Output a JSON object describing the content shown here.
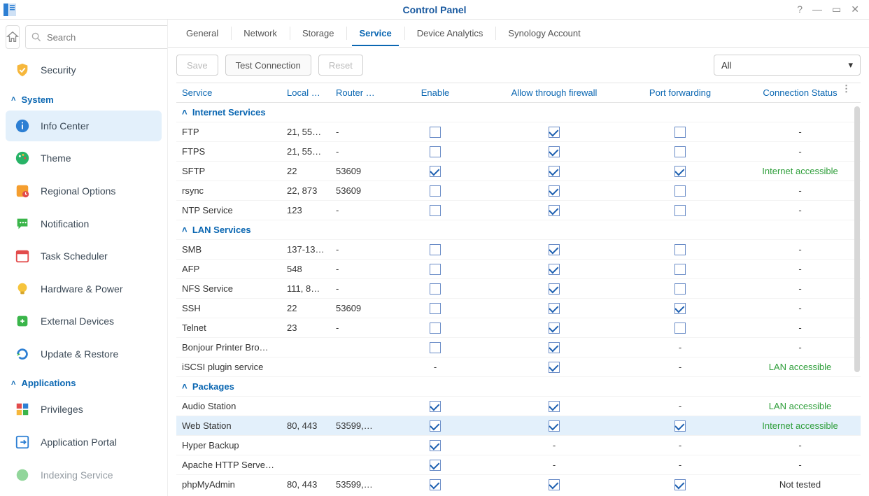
{
  "window": {
    "title": "Control Panel"
  },
  "sidebar": {
    "search_placeholder": "Search",
    "security_label": "Security",
    "groups": {
      "system": {
        "label": "System"
      },
      "applications": {
        "label": "Applications"
      }
    },
    "items": {
      "info_center": "Info Center",
      "theme": "Theme",
      "regional": "Regional Options",
      "notification": "Notification",
      "task_scheduler": "Task Scheduler",
      "hardware_power": "Hardware & Power",
      "external_devices": "External Devices",
      "update_restore": "Update & Restore",
      "privileges": "Privileges",
      "app_portal": "Application Portal",
      "indexing": "Indexing Service"
    }
  },
  "tabs": {
    "general": "General",
    "network": "Network",
    "storage": "Storage",
    "service": "Service",
    "device_analytics": "Device Analytics",
    "synology_account": "Synology Account"
  },
  "toolbar": {
    "save": "Save",
    "test": "Test Connection",
    "reset": "Reset",
    "filter": "All"
  },
  "columns": {
    "service": "Service",
    "local_port": "Local P…",
    "router_port": "Router …",
    "enable": "Enable",
    "firewall": "Allow through firewall",
    "port_forwarding": "Port forwarding",
    "conn_status": "Connection Status"
  },
  "sections": {
    "internet": "Internet Services",
    "lan": "LAN Services",
    "packages": "Packages"
  },
  "rows": {
    "ftp": {
      "name": "FTP",
      "local": "21, 55…",
      "router": "-",
      "en": false,
      "fw": true,
      "pf": false,
      "pf_box": true,
      "status": "-"
    },
    "ftps": {
      "name": "FTPS",
      "local": "21, 55…",
      "router": "-",
      "en": false,
      "fw": true,
      "pf": false,
      "pf_box": true,
      "status": "-"
    },
    "sftp": {
      "name": "SFTP",
      "local": "22",
      "router": "53609",
      "en": true,
      "fw": true,
      "pf": true,
      "pf_box": true,
      "status": "Internet accessible",
      "green": true
    },
    "rsync": {
      "name": "rsync",
      "local": "22, 873",
      "router": "53609",
      "en": false,
      "fw": true,
      "pf": false,
      "pf_box": true,
      "status": "-"
    },
    "ntp": {
      "name": "NTP Service",
      "local": "123",
      "router": "-",
      "en": false,
      "fw": true,
      "pf": false,
      "pf_box": true,
      "status": "-"
    },
    "smb": {
      "name": "SMB",
      "local": "137-13…",
      "router": "-",
      "en": false,
      "fw": true,
      "pf": false,
      "pf_box": true,
      "status": "-"
    },
    "afp": {
      "name": "AFP",
      "local": "548",
      "router": "-",
      "en": false,
      "fw": true,
      "pf": false,
      "pf_box": true,
      "status": "-"
    },
    "nfs": {
      "name": "NFS Service",
      "local": "111, 8…",
      "router": "-",
      "en": false,
      "fw": true,
      "pf": false,
      "pf_box": true,
      "status": "-"
    },
    "ssh": {
      "name": "SSH",
      "local": "22",
      "router": "53609",
      "en": false,
      "fw": true,
      "pf": true,
      "pf_box": true,
      "status": "-"
    },
    "telnet": {
      "name": "Telnet",
      "local": "23",
      "router": "-",
      "en": false,
      "fw": true,
      "pf": false,
      "pf_box": true,
      "status": "-"
    },
    "bonjour": {
      "name": "Bonjour Printer Bro…",
      "local": "",
      "router": "",
      "en": false,
      "fw": true,
      "pf_dash": true,
      "status": "-"
    },
    "iscsi": {
      "name": "iSCSI plugin service",
      "local": "",
      "router": "",
      "en_dash": true,
      "fw": true,
      "pf_dash": true,
      "status": "LAN accessible",
      "green": true
    },
    "audio": {
      "name": "Audio Station",
      "local": "",
      "router": "",
      "en": true,
      "fw": true,
      "pf_dash": true,
      "status": "LAN accessible",
      "green": true
    },
    "web": {
      "name": "Web Station",
      "local": "80, 443",
      "router": "53599,…",
      "en": true,
      "fw": true,
      "pf": true,
      "pf_box": true,
      "status": "Internet accessible",
      "green": true
    },
    "hyper": {
      "name": "Hyper Backup",
      "local": "",
      "router": "",
      "en": true,
      "fw_dash": true,
      "pf_dash": true,
      "status": "-"
    },
    "apache": {
      "name": "Apache HTTP Serve…",
      "local": "",
      "router": "",
      "en": true,
      "fw_dash": true,
      "pf_dash": true,
      "status": "-"
    },
    "pma": {
      "name": "phpMyAdmin",
      "local": "80, 443",
      "router": "53599,…",
      "en": true,
      "fw": true,
      "pf": true,
      "pf_box": true,
      "status": "Not tested"
    }
  }
}
